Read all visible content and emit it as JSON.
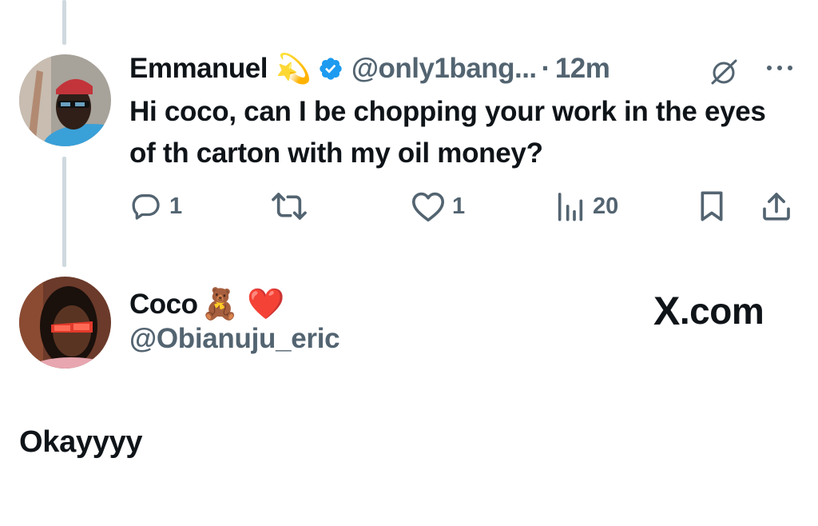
{
  "tweet": {
    "author_name": "Emmanuel",
    "author_emoji": "💫",
    "handle": "@only1bang...",
    "separator": "·",
    "time": "12m",
    "more_label": "···",
    "text": "Hi coco, can I be chopping your work in the eyes of th carton with my oil money?",
    "metrics": {
      "replies": "1",
      "likes": "1",
      "views": "20"
    }
  },
  "reply": {
    "author_name": "Coco",
    "author_emojis": "🧸 ❤️",
    "handle": "@Obianuju_eric",
    "text": "Okayyyy"
  },
  "brand": {
    "logo_letter": "X",
    "domain": ".com"
  },
  "colors": {
    "text": "#0f1419",
    "muted": "#536471",
    "verified": "#1d9bf0",
    "thread_line": "#cfd9de",
    "heart": "#e0245e"
  },
  "icons": [
    "reply-icon",
    "retweet-icon",
    "like-icon",
    "views-icon",
    "bookmark-icon",
    "share-icon",
    "grok-icon",
    "more-icon",
    "verified-badge-icon"
  ]
}
